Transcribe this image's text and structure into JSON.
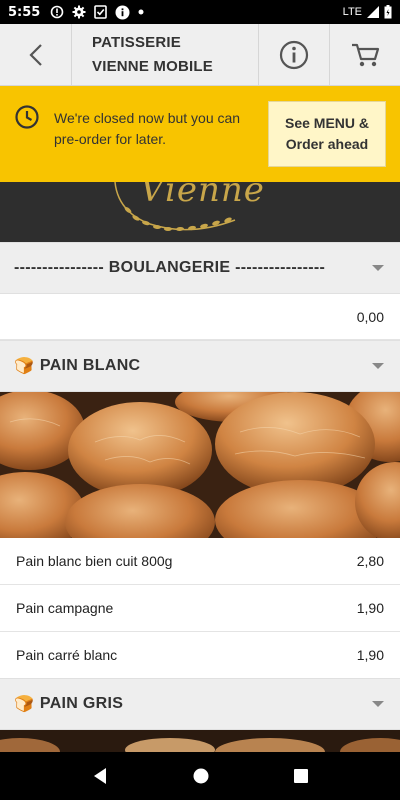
{
  "status_bar": {
    "time": "5:55",
    "network": "LTE",
    "icons": [
      "notification-icon",
      "settings-icon",
      "checklist-icon",
      "info-icon",
      "dot-icon"
    ]
  },
  "app_bar": {
    "title_line1": "PATISSERIE",
    "title_line2": "VIENNE MOBILE",
    "back_icon": "chevron-left-icon",
    "info_icon": "info-icon",
    "cart_icon": "cart-icon"
  },
  "banner": {
    "message": "We're closed now but you can pre-order for later.",
    "cta_line1": "See MENU &",
    "cta_line2": "Order ahead",
    "icon": "clock-icon",
    "color": "#f8c400"
  },
  "logo": {
    "text": "Vienne"
  },
  "sections": [
    {
      "title": "---------------- BOULANGERIE ----------------",
      "items": [
        {
          "name": "",
          "price": "0,00"
        }
      ]
    },
    {
      "emoji": "🍞",
      "title": "PAIN BLANC",
      "items": [
        {
          "name": "Pain blanc bien cuit 800g",
          "price": "2,80"
        },
        {
          "name": "Pain campagne",
          "price": "1,90"
        },
        {
          "name": "Pain carré blanc",
          "price": "1,90"
        }
      ]
    },
    {
      "emoji": "🍞",
      "title": "PAIN GRIS",
      "items": []
    }
  ],
  "nav": {
    "back": "back-triangle-icon",
    "home": "home-circle-icon",
    "recents": "recents-square-icon"
  }
}
